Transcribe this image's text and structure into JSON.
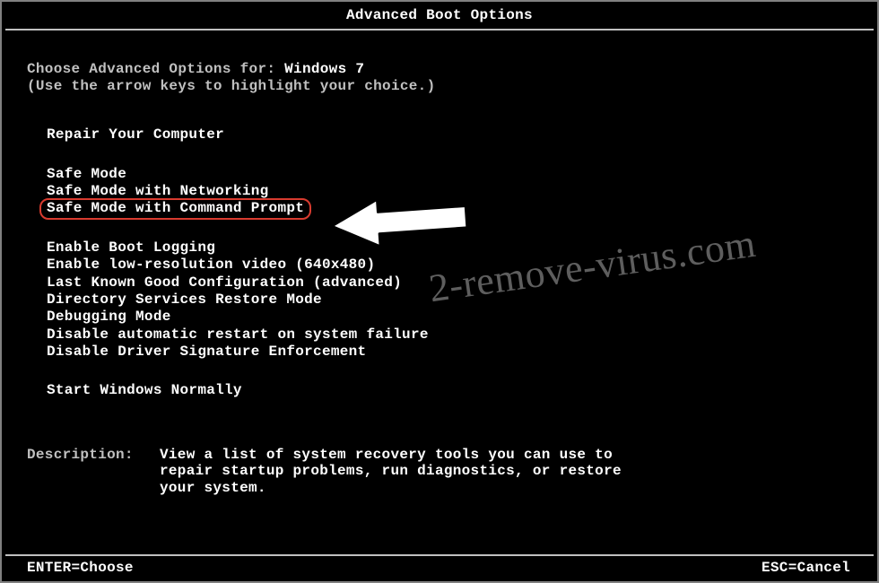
{
  "title": "Advanced Boot Options",
  "prompt": "Choose Advanced Options for: ",
  "os": "Windows 7",
  "hint": "(Use the arrow keys to highlight your choice.)",
  "groups": {
    "g0": [
      "Repair Your Computer"
    ],
    "g1": [
      "Safe Mode",
      "Safe Mode with Networking",
      "Safe Mode with Command Prompt"
    ],
    "g2": [
      "Enable Boot Logging",
      "Enable low-resolution video (640x480)",
      "Last Known Good Configuration (advanced)",
      "Directory Services Restore Mode",
      "Debugging Mode",
      "Disable automatic restart on system failure",
      "Disable Driver Signature Enforcement"
    ],
    "g3": [
      "Start Windows Normally"
    ]
  },
  "highlighted_index": {
    "group": "g1",
    "i": 2
  },
  "description": {
    "label": "Description:",
    "text": "View a list of system recovery tools you can use to repair startup problems, run diagnostics, or restore your system."
  },
  "footer": {
    "left": "ENTER=Choose",
    "right": "ESC=Cancel"
  },
  "watermark": "2-remove-virus.com",
  "annotation_color": "#d83b2f"
}
